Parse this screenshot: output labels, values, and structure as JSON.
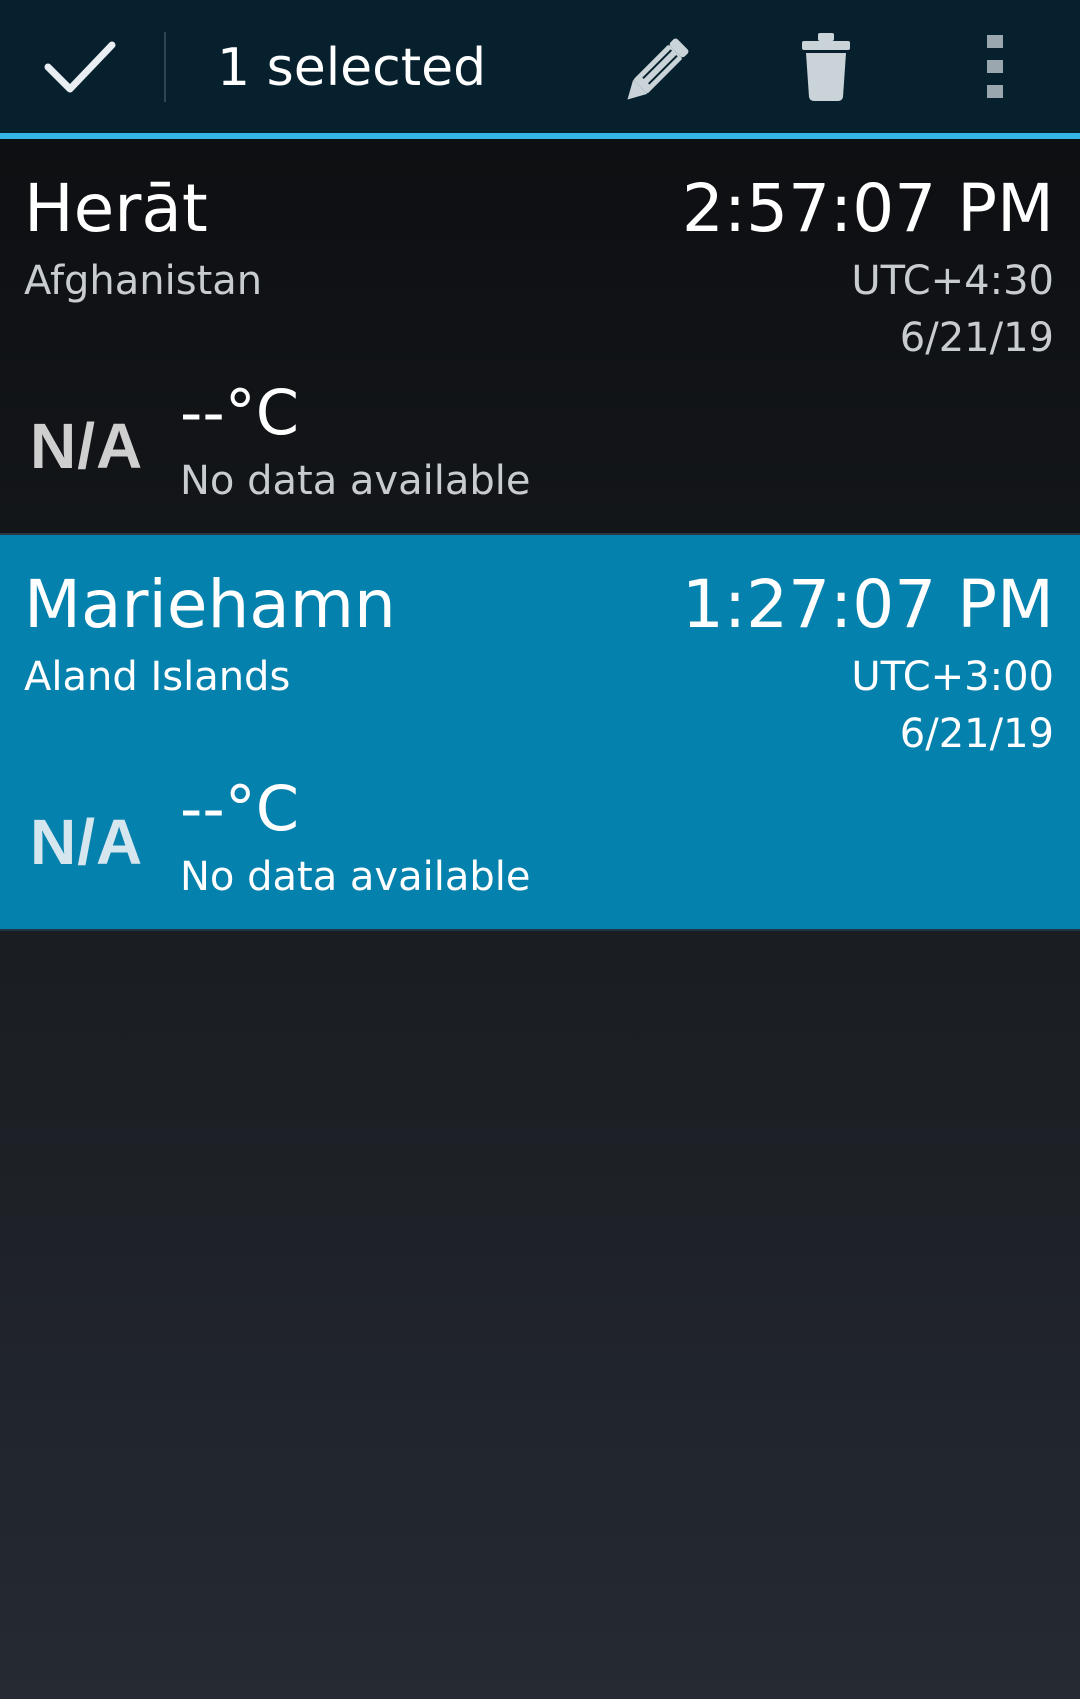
{
  "action_bar": {
    "title": "1 selected",
    "icons": {
      "done": "checkmark-icon",
      "edit": "pencil-icon",
      "delete": "trash-icon",
      "overflow": "more-vert-icon"
    }
  },
  "colors": {
    "action_bar_bg": "#06202d",
    "accent_line": "#33b5e5",
    "selected_row": "#0581ad",
    "background": "#1b1e22"
  },
  "cities": [
    {
      "city": "Herāt",
      "country": "Afghanistan",
      "time": "2:57:07 PM",
      "utc": "UTC+4:30",
      "date": "6/21/19",
      "weather_icon": "N/A",
      "temperature": "--°C",
      "condition": "No data available",
      "selected": false
    },
    {
      "city": "Mariehamn",
      "country": "Aland Islands",
      "time": "1:27:07 PM",
      "utc": "UTC+3:00",
      "date": "6/21/19",
      "weather_icon": "N/A",
      "temperature": "--°C",
      "condition": "No data available",
      "selected": true
    }
  ]
}
